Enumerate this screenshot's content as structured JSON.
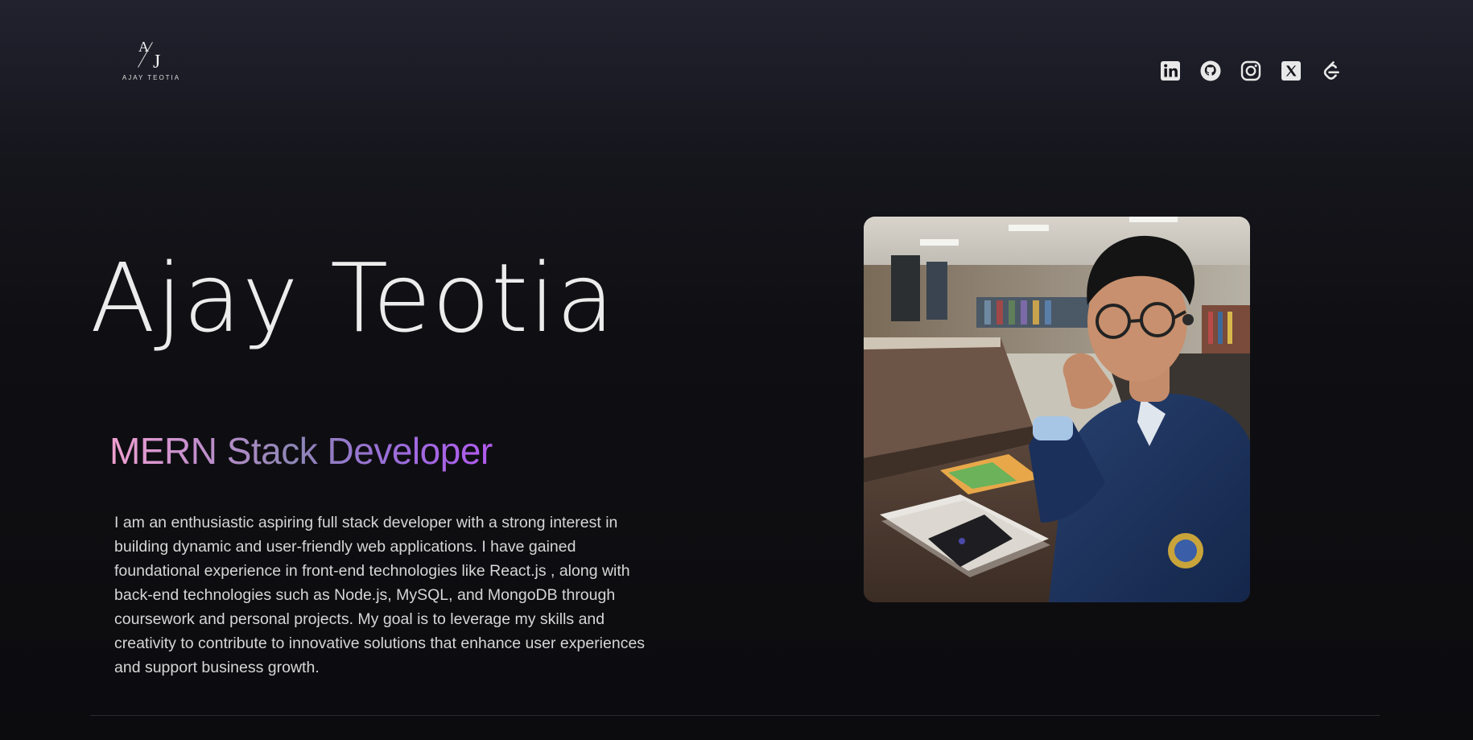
{
  "logo": {
    "mark_a": "A",
    "mark_j": "J",
    "text": "AJAY TEOTIA"
  },
  "socials": [
    {
      "name": "linkedin-icon"
    },
    {
      "name": "github-icon"
    },
    {
      "name": "instagram-icon"
    },
    {
      "name": "x-twitter-icon"
    },
    {
      "name": "leetcode-icon"
    }
  ],
  "hero": {
    "name": "Ajay Teotia",
    "role": "MERN Stack Developer",
    "bio": "I am an enthusiastic aspiring full stack developer with a strong interest in building dynamic and user-friendly web applications. I have gained foundational experience in front-end technologies like React.js , along with back-end technologies such as Node.js, MySQL, and MongoDB through coursework and personal projects. My goal is to leverage my skills and creativity to contribute to innovative solutions that enhance user experiences and support business growth."
  },
  "colors": {
    "background": "#0c0c0f",
    "text": "#e6e6e6",
    "role_gradient_start": "#f0a0d0",
    "role_gradient_end": "#b25af0"
  }
}
